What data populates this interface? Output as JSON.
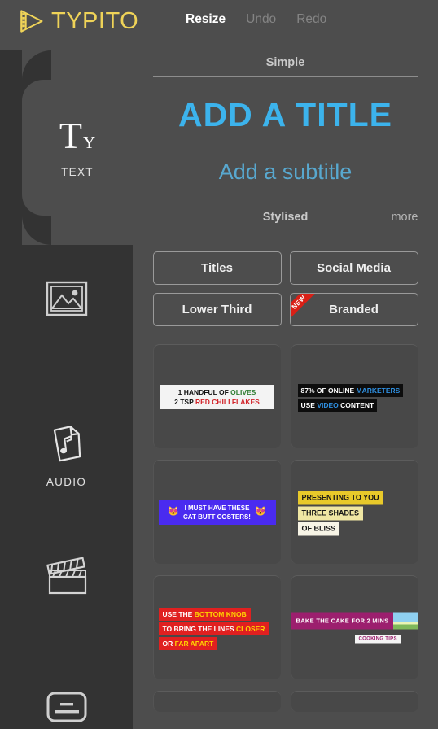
{
  "app": {
    "name": "TYPITO",
    "logo_icon": "film-play-logo-icon",
    "brand_color": "#efd358",
    "accent_color": "#3cb3ec"
  },
  "header": {
    "nav": [
      {
        "label": "Resize",
        "state": "active"
      },
      {
        "label": "Undo",
        "state": "disabled"
      },
      {
        "label": "Redo",
        "state": "disabled"
      }
    ]
  },
  "sidebar": {
    "items": [
      {
        "label": "TEXT",
        "icon": "text-ty-icon",
        "active": true
      },
      {
        "label": "",
        "icon": "image-icon",
        "active": false
      },
      {
        "label": "AUDIO",
        "icon": "audio-file-icon",
        "active": false
      },
      {
        "label": "",
        "icon": "clapperboard-icon",
        "active": false
      },
      {
        "label": "",
        "icon": "subtitles-icon",
        "active": false
      }
    ]
  },
  "main": {
    "simple_tab": {
      "label": "Simple"
    },
    "preview": {
      "title": "ADD A TITLE",
      "subtitle": "Add a subtitle"
    },
    "stylised_tab": {
      "label": "Stylised",
      "more_label": "more"
    },
    "categories": [
      {
        "label": "Titles",
        "badge": ""
      },
      {
        "label": "Social Media",
        "badge": ""
      },
      {
        "label": "Lower Third",
        "badge": ""
      },
      {
        "label": "Branded",
        "badge": "NEW"
      }
    ],
    "templates": [
      {
        "name": "olives-recipe-template",
        "style": "white-bar",
        "lines": [
          [
            {
              "t": "1 HANDFUL OF ",
              "c": "dark"
            },
            {
              "t": "OLIVES",
              "c": "green"
            }
          ],
          [
            {
              "t": "2 TSP ",
              "c": "dark"
            },
            {
              "t": "RED CHILI FLAKES",
              "c": "red"
            }
          ]
        ]
      },
      {
        "name": "marketers-stat-template",
        "style": "black-bars",
        "lines": [
          [
            {
              "t": "87% OF ONLINE ",
              "c": "white"
            },
            {
              "t": "MARKETERS",
              "c": "blue"
            }
          ],
          [
            {
              "t": "USE ",
              "c": "white"
            },
            {
              "t": "VIDEO",
              "c": "blue"
            },
            {
              "t": " CONTENT",
              "c": "white"
            }
          ]
        ]
      },
      {
        "name": "cat-coasters-template",
        "style": "purple-bar-emoji",
        "emoji_left": "😻",
        "emoji_right": "😻",
        "lines": [
          [
            {
              "t": "I MUST HAVE THESE",
              "c": "white"
            }
          ],
          [
            {
              "t": "CAT BUTT COSTERS!",
              "c": "white"
            }
          ]
        ]
      },
      {
        "name": "three-shades-template",
        "style": "yellow-gradient-bars",
        "bars": [
          {
            "text": "PRESENTING TO YOU",
            "bg": "#e8c92a"
          },
          {
            "text": "THREE SHADES",
            "bg": "#efe6a3"
          },
          {
            "text": "OF BLISS",
            "bg": "#f7f4e6"
          }
        ]
      },
      {
        "name": "bottom-knob-tip-template",
        "style": "red-bars",
        "lines": [
          [
            {
              "t": "USE THE ",
              "c": "white"
            },
            {
              "t": "BOTTOM KNOB",
              "c": "yellow"
            }
          ],
          [
            {
              "t": "TO BRING THE LINES ",
              "c": "white"
            },
            {
              "t": "CLOSER",
              "c": "yellow"
            }
          ],
          [
            {
              "t": "OR ",
              "c": "white"
            },
            {
              "t": "FAR APART",
              "c": "yellow"
            }
          ]
        ]
      },
      {
        "name": "bake-cake-template",
        "style": "magenta-lower-third",
        "headline": "BAKE THE CAKE FOR 2 MINS",
        "sublabel": "COOKING TIPS"
      }
    ]
  }
}
